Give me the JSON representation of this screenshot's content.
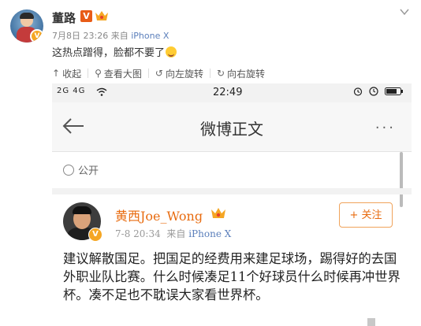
{
  "author": {
    "name": "董路",
    "verified_label": "V",
    "timestamp": "7月8日 23:26",
    "source_prefix": "来自",
    "device": "iPhone X"
  },
  "post": {
    "text": "这热点蹭得，脸都不要了"
  },
  "toolbar": {
    "collapse_label": "收起",
    "view_large_label": "查看大图",
    "rotate_left_label": "向左旋转",
    "rotate_right_label": "向右旋转"
  },
  "phone": {
    "status_left": "2G 4G",
    "time": "22:49",
    "nav_title": "微博正文",
    "more_label": "···",
    "visibility": "公开",
    "poster": {
      "name": "黄西Joe_Wong",
      "verified_label": "V",
      "date": "7-8 20:34",
      "source_prefix": "来自",
      "device": "iPhone X",
      "follow_label": "+ 关注"
    },
    "content": "建议解散国足。把国足的经费用来建足球场，踢得好的去国外职业队比赛。什么时候凑足11个好球员什么时候再冲世界杯。凑不足也不耽误大家看世界杯。"
  },
  "colors": {
    "accent": "#e86b0f",
    "link": "#5b7fbb",
    "verified": "#f5a623"
  }
}
